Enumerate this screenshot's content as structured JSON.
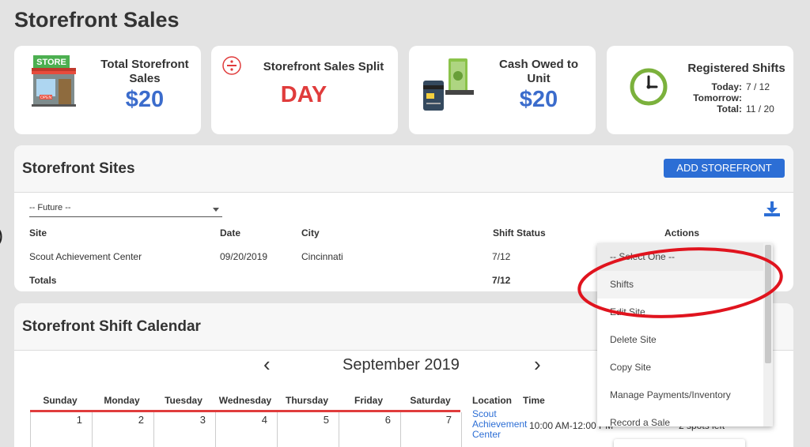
{
  "page": {
    "title": "Storefront Sales",
    "edge_text": ")"
  },
  "cards": {
    "total_sales": {
      "label": "Total Storefront Sales",
      "value": "$20",
      "icon": "store-icon",
      "store_sign": "STORE",
      "open_sign": "OPEN"
    },
    "sales_split": {
      "label": "Storefront Sales Split",
      "value": "DAY",
      "icon": "divide-icon"
    },
    "cash_owed": {
      "label": "Cash Owed to Unit",
      "value": "$20",
      "icon": "cash-card-icon"
    },
    "shifts": {
      "label": "Registered Shifts",
      "icon": "clock-icon",
      "today_label": "Today:",
      "today_value": "7 / 12",
      "tomorrow_label": "Tomorrow:",
      "tomorrow_value": "",
      "total_label": "Total:",
      "total_value": "11 / 20"
    }
  },
  "colors": {
    "accent_blue": "#2c6ed5",
    "value_blue": "#3b6ccc",
    "split_red": "#e03c3c",
    "calendar_red": "#e03c3c",
    "annotation_red": "#e0141e",
    "icon_green": "#7bb13c"
  },
  "sites": {
    "title": "Storefront Sites",
    "add_button": "ADD STOREFRONT",
    "filter_value": "-- Future --",
    "download_icon": "download-icon",
    "columns": {
      "site": "Site",
      "date": "Date",
      "city": "City",
      "shift_status": "Shift Status",
      "actions": "Actions"
    },
    "rows": [
      {
        "site": "Scout Achievement Center",
        "date": "09/20/2019",
        "city": "Cincinnati",
        "shift_status": "7/12"
      }
    ],
    "totals": {
      "label": "Totals",
      "shift_status": "7/12"
    }
  },
  "actions_dropdown": {
    "items": [
      "-- Select One --",
      "Shifts",
      "Edit Site",
      "Delete Site",
      "Copy Site",
      "Manage Payments/Inventory",
      "Record a Sale"
    ]
  },
  "calendar": {
    "title": "Storefront Shift Calendar",
    "month": "September 2019",
    "prev": "‹",
    "next": "›",
    "days_of_week": [
      "Sunday",
      "Monday",
      "Tuesday",
      "Wednesday",
      "Thursday",
      "Friday",
      "Saturday"
    ],
    "first_week": [
      "1",
      "2",
      "3",
      "4",
      "5",
      "6",
      "7"
    ],
    "list_headers": {
      "location": "Location",
      "time": "Time"
    },
    "entries": [
      {
        "location_line1": "Scout",
        "location_line2": "Achievement",
        "location_line3": "Center",
        "time": "10:00 AM-12:00 PM",
        "spots": "2 spots left"
      }
    ]
  }
}
